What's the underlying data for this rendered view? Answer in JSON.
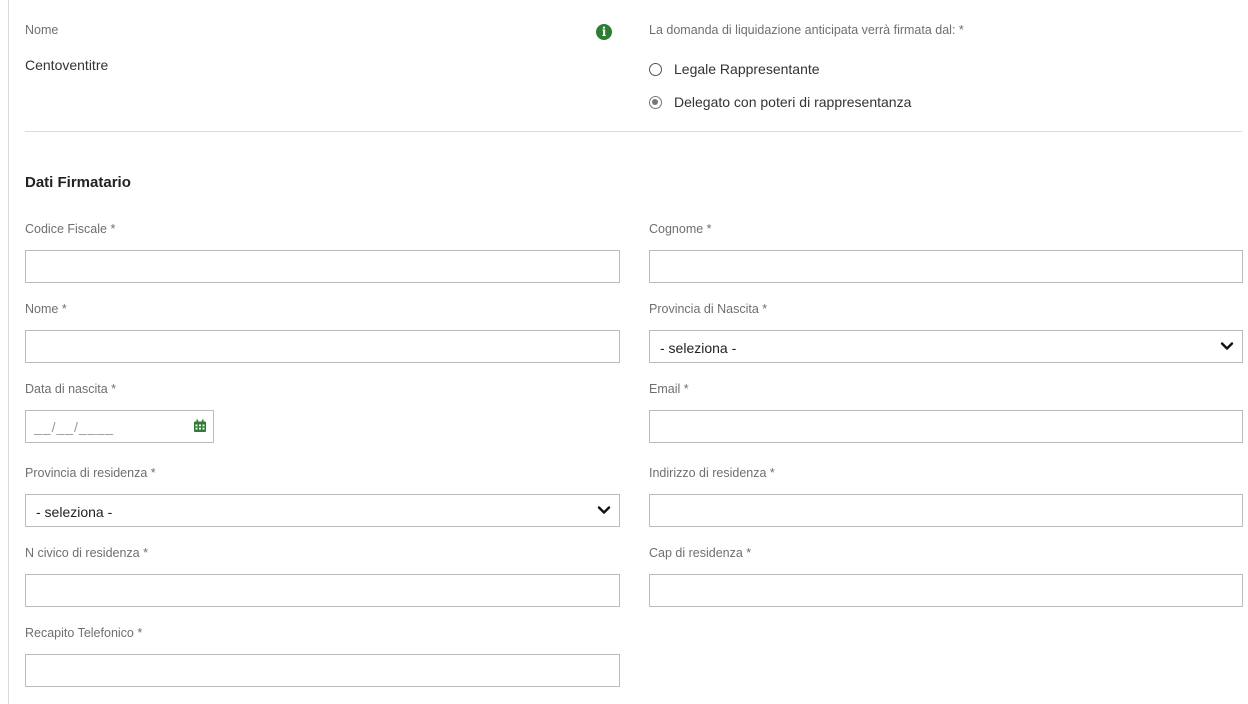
{
  "header": {
    "name_label": "Nome",
    "name_value": "Centoventitre",
    "info_icon": "info-icon",
    "signer_question": "La domanda di liquidazione anticipata verrà firmata dal: *",
    "signer_options": [
      {
        "label": "Legale Rappresentante",
        "selected": false
      },
      {
        "label": "Delegato con poteri di rappresentanza",
        "selected": true
      }
    ]
  },
  "section": {
    "title": "Dati Firmatario"
  },
  "fields": {
    "codice_fiscale": {
      "label": "Codice Fiscale *",
      "value": ""
    },
    "cognome": {
      "label": "Cognome *",
      "value": ""
    },
    "nome": {
      "label": "Nome *",
      "value": ""
    },
    "provincia_nascita": {
      "label": "Provincia di Nascita *",
      "selected": "- seleziona -"
    },
    "data_nascita": {
      "label": "Data di nascita *",
      "placeholder": "__/__/____",
      "icon": "calendar-icon"
    },
    "email": {
      "label": "Email *",
      "value": ""
    },
    "provincia_residenza": {
      "label": "Provincia di residenza *",
      "selected": "- seleziona -"
    },
    "indirizzo_residenza": {
      "label": "Indirizzo di residenza *",
      "value": ""
    },
    "civico_residenza": {
      "label": "N civico di residenza *",
      "value": ""
    },
    "cap_residenza": {
      "label": "Cap di residenza *",
      "value": ""
    },
    "recapito_telefonico": {
      "label": "Recapito Telefonico *",
      "value": ""
    }
  },
  "colors": {
    "info_icon": "#2e7d32",
    "calendar_icon": "#2e7d32",
    "border": "#bcbcbc"
  }
}
